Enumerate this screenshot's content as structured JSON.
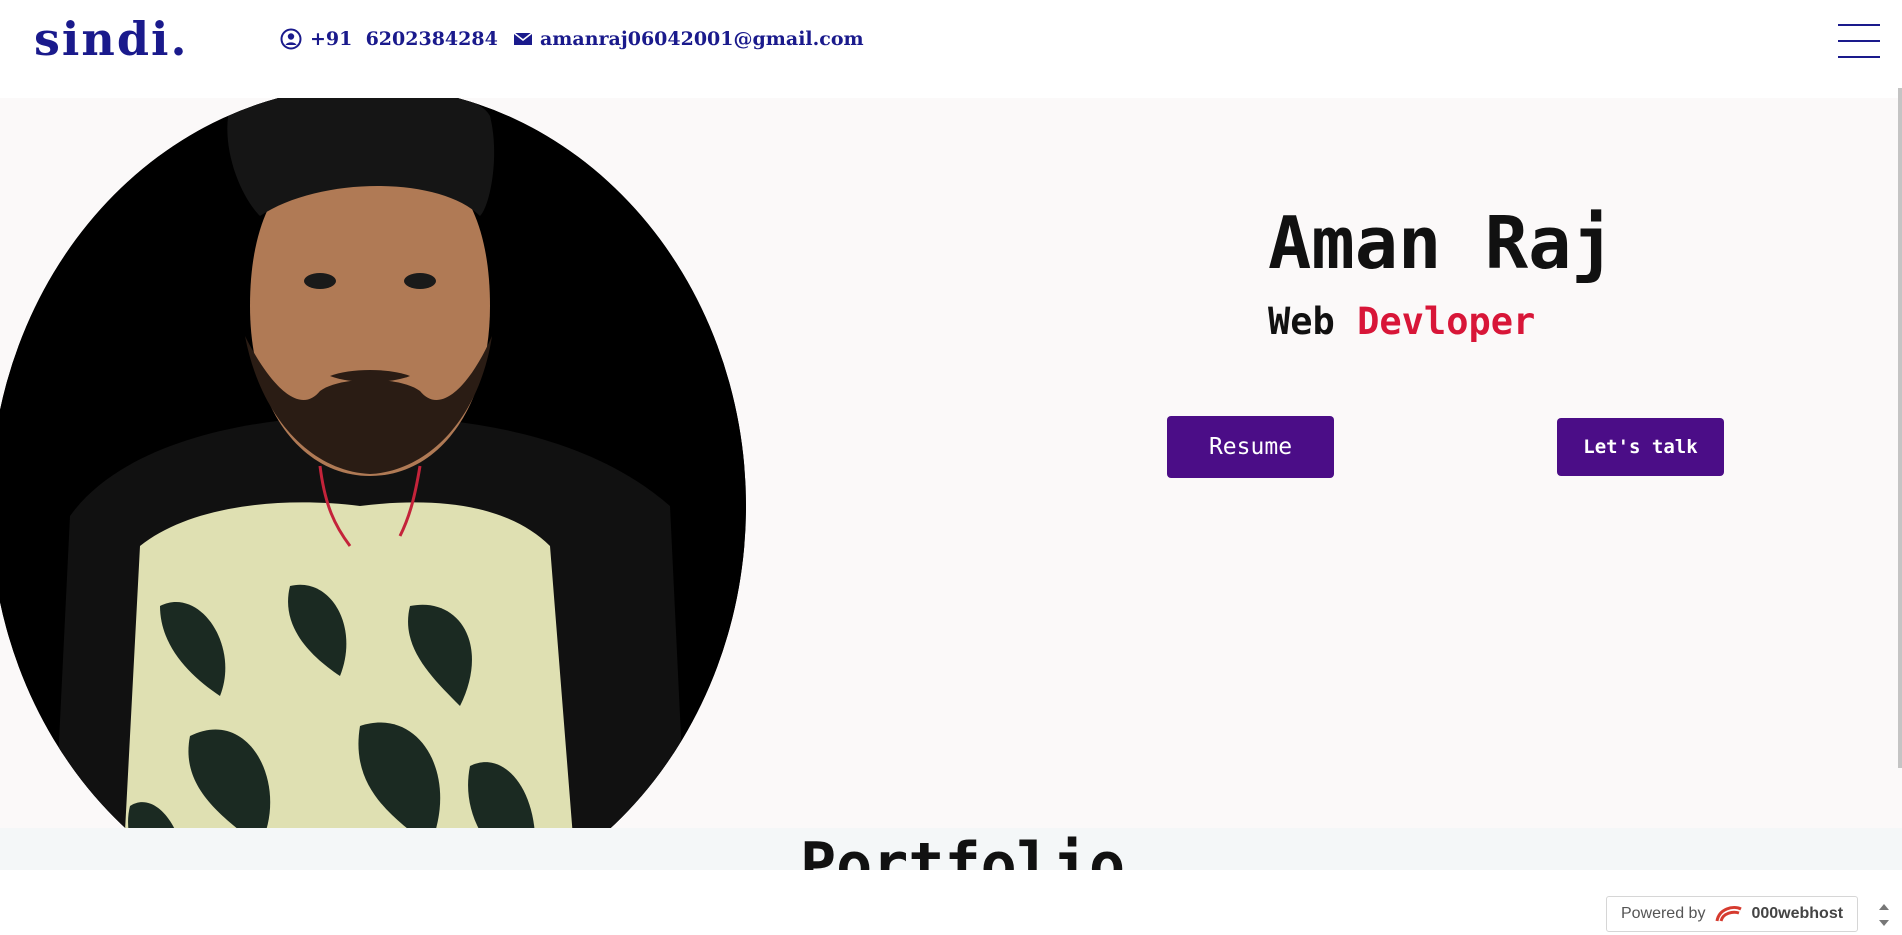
{
  "header": {
    "logo": "sindi.",
    "phone": "+91  6202384284",
    "email": "amanraj06042001@gmail.com",
    "icons": [
      "user-circle-icon",
      "mail-icon",
      "hamburger-menu-icon"
    ]
  },
  "hero": {
    "name": "Aman Raj",
    "role_primary": "Web",
    "role_accent": "Devloper",
    "resume_button": "Resume",
    "talk_button": "Let's talk",
    "image": "profile-photo"
  },
  "portfolio": {
    "title": "Portfolio"
  },
  "footer_badge": {
    "prefix": "Powered by",
    "brand": "000webhost"
  },
  "colors": {
    "navy": "#1a1a8c",
    "purple": "#4b0d87",
    "accent_red": "#d81638",
    "background": "#fbf9f9"
  }
}
